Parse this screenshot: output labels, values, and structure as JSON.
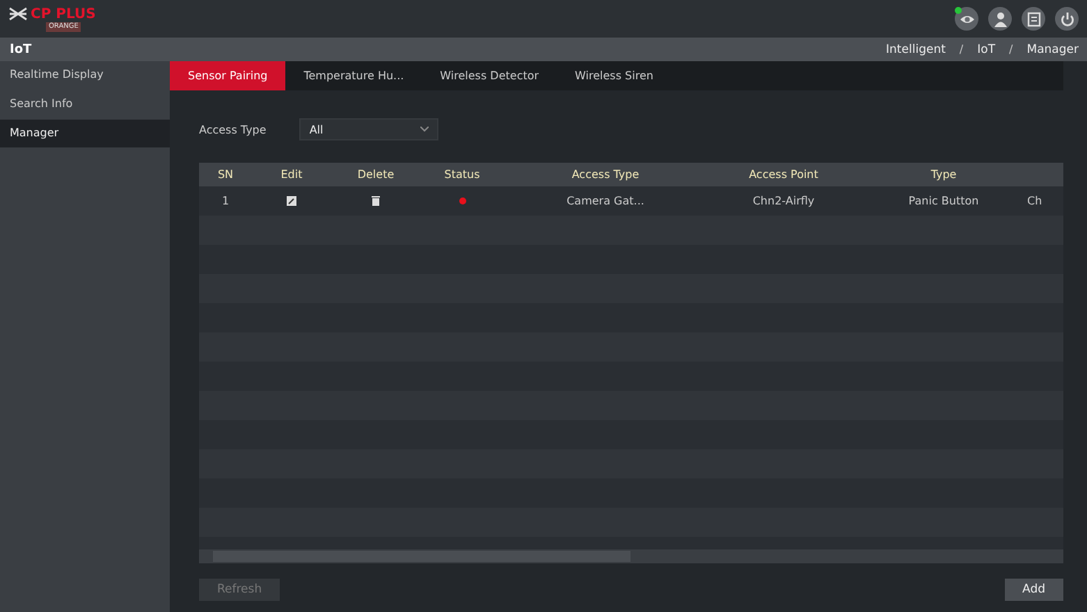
{
  "logo": {
    "brand": "CP PLUS",
    "sub": "ORANGE"
  },
  "header_icons": [
    {
      "kind": "eye",
      "badge": true
    },
    {
      "kind": "user",
      "badge": false
    },
    {
      "kind": "list",
      "badge": false
    },
    {
      "kind": "power",
      "badge": false
    }
  ],
  "section_title": "IoT",
  "breadcrumb": [
    {
      "kind": "link",
      "text": "Intelligent"
    },
    {
      "kind": "separator",
      "text": "/"
    },
    {
      "kind": "link",
      "text": "IoT"
    },
    {
      "kind": "separator",
      "text": "/"
    },
    {
      "kind": "link",
      "text": "Manager"
    }
  ],
  "sidebar": {
    "items": [
      {
        "label": "Realtime Display",
        "selected": false
      },
      {
        "label": "Search Info",
        "selected": false
      },
      {
        "label": "Manager",
        "selected": true
      }
    ]
  },
  "tabs": [
    {
      "label": "Sensor Pairing",
      "selected": true
    },
    {
      "label": "Temperature Hu...",
      "selected": false
    },
    {
      "label": "Wireless Detector",
      "selected": false
    },
    {
      "label": "Wireless Siren",
      "selected": false
    }
  ],
  "filter": {
    "label": "Access Type",
    "value": "All"
  },
  "table": {
    "columns": [
      "SN",
      "Edit",
      "Delete",
      "Status",
      "Access Type",
      "Access Point",
      "Type"
    ],
    "rows": [
      {
        "sn": "1",
        "color": "#e8101c",
        "access_type": "Camera Gat...",
        "access_point": "Chn2-Airfly",
        "type": "Panic Button",
        "column_8": "Ch"
      }
    ]
  },
  "buttons": [
    {
      "label": "Refresh",
      "disabled": true
    },
    {
      "label": "Add",
      "disabled": false
    }
  ]
}
